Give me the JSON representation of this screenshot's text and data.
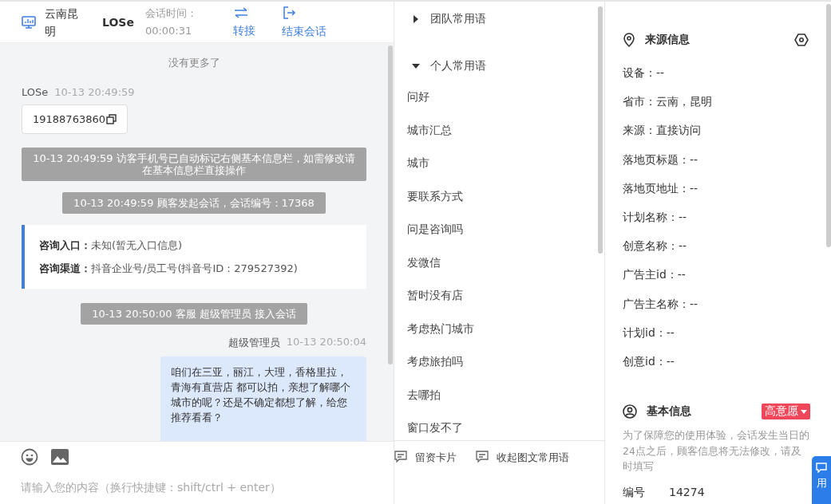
{
  "header": {
    "location": "云南昆明",
    "visitor": "LOSe",
    "timer_label": "会话时间：",
    "timer": "00:00:31",
    "actions": [
      {
        "label": "转接",
        "kind": "transfer"
      },
      {
        "label": "结束会话",
        "kind": "end"
      }
    ]
  },
  "chat": {
    "no_more": "没有更多了",
    "messages": [
      {
        "kind": "visitor",
        "sender": "LOSe",
        "time": "10-13 20:49:59",
        "text": "19188763860"
      },
      {
        "kind": "system",
        "text": "10-13 20:49:59 访客手机号已自动标记右侧基本信息栏，如需修改请在基本信息栏直接操作"
      },
      {
        "kind": "system",
        "text": "10-13 20:49:59 顾客发起会话，会话编号：17368"
      },
      {
        "kind": "entry",
        "rows": [
          {
            "label": "咨询入口：",
            "value": "未知(暂无入口信息)"
          },
          {
            "label": "咨询渠道：",
            "value": "抖音企业号/员工号(抖音号ID：279527392)"
          }
        ]
      },
      {
        "kind": "system",
        "text": "10-13 20:50:00 客服 超级管理员 接入会话"
      },
      {
        "kind": "agent",
        "sender": "超级管理员",
        "time": "10-13 20:50:04",
        "text": "咱们在三亚，丽江，大理，香格里拉，青海有直营店 都可以拍，亲想了解哪个城市的呢？还是不确定都想了解，给您推荐看看？"
      }
    ]
  },
  "composer": {
    "placeholder": "请输入您的内容（换行快捷键：shift/ctrl + enter）"
  },
  "phrases": {
    "groups": [
      {
        "title": "团队常用语",
        "expanded": false
      },
      {
        "title": "个人常用语",
        "expanded": true,
        "children": [
          "问好",
          "城市汇总",
          "城市",
          "要联系方式",
          "问是咨询吗",
          "发微信",
          "暂时没有店",
          "考虑热门城市",
          "考虑旅拍吗",
          "去哪拍",
          "窗口发不了"
        ]
      }
    ],
    "tools": [
      "留资卡片",
      "收起图文常用语"
    ]
  },
  "source_info": {
    "title": "来源信息",
    "fields": [
      "设备：--",
      "省市：云南，昆明",
      "来源：直接访问",
      "落地页标题：--",
      "落地页地址：--",
      "计划名称：--",
      "创意名称：--",
      "广告主id：--",
      "广告主名称：--",
      "计划id：--",
      "创意id：--"
    ]
  },
  "basic_info": {
    "title": "基本信息",
    "intent": "高意愿",
    "notice": "为了保障您的使用体验，会话发生当日的24点之后，顾客信息将无法修改，请及时填写",
    "fields": [
      {
        "label": "编号",
        "value": "14274"
      }
    ]
  },
  "side_tab": {
    "label": "用"
  }
}
